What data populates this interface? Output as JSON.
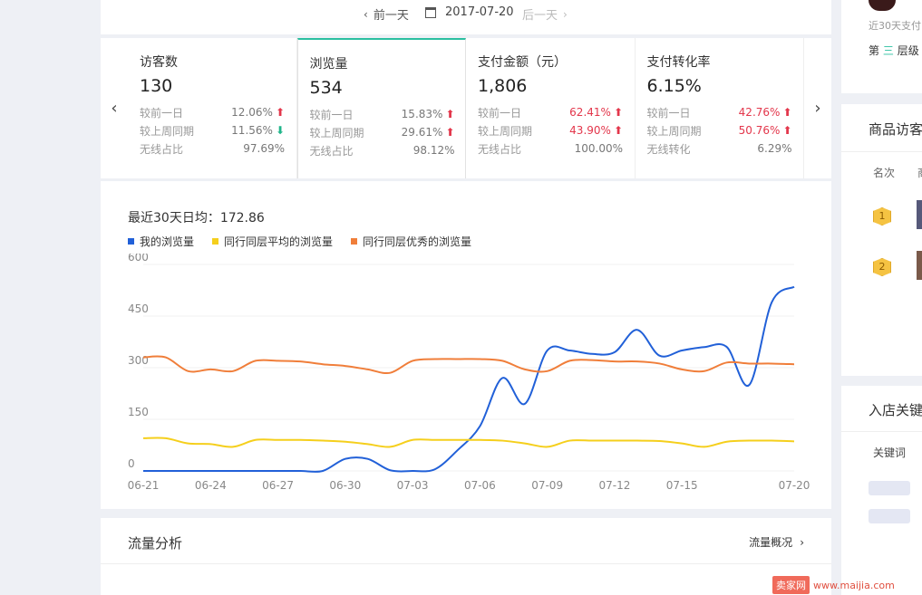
{
  "date_bar": {
    "prev_label": "前一天",
    "date": "2017-07-20",
    "next_label": "后一天"
  },
  "metrics": [
    {
      "title": "访客数",
      "value": "130",
      "rows": [
        {
          "label": "较前一日",
          "pct": "12.06%",
          "trend": "up",
          "emph": false
        },
        {
          "label": "较上周同期",
          "pct": "11.56%",
          "trend": "down",
          "emph": false
        },
        {
          "label": "无线占比",
          "pct": "97.69%",
          "trend": "",
          "emph": false
        }
      ]
    },
    {
      "title": "浏览量",
      "value": "534",
      "rows": [
        {
          "label": "较前一日",
          "pct": "15.83%",
          "trend": "up",
          "emph": false
        },
        {
          "label": "较上周同期",
          "pct": "29.61%",
          "trend": "up",
          "emph": false
        },
        {
          "label": "无线占比",
          "pct": "98.12%",
          "trend": "",
          "emph": false
        }
      ]
    },
    {
      "title": "支付金额（元）",
      "value": "1,806",
      "rows": [
        {
          "label": "较前一日",
          "pct": "62.41%",
          "trend": "up",
          "emph": true
        },
        {
          "label": "较上周同期",
          "pct": "43.90%",
          "trend": "up",
          "emph": true
        },
        {
          "label": "无线占比",
          "pct": "100.00%",
          "trend": "",
          "emph": false
        }
      ]
    },
    {
      "title": "支付转化率",
      "value": "6.15%",
      "rows": [
        {
          "label": "较前一日",
          "pct": "42.76%",
          "trend": "up",
          "emph": true
        },
        {
          "label": "较上周同期",
          "pct": "50.76%",
          "trend": "up",
          "emph": true
        },
        {
          "label": "无线转化",
          "pct": "6.29%",
          "trend": "",
          "emph": false
        }
      ]
    }
  ],
  "chart_panel": {
    "avg_text": "最近30天日均：172.86",
    "legend": [
      {
        "name": "我的浏览量",
        "color": "#2160d8"
      },
      {
        "name": "同行同层平均的浏览量",
        "color": "#f5cf1c"
      },
      {
        "name": "同行同层优秀的浏览量",
        "color": "#f07e3a"
      }
    ]
  },
  "chart_data": {
    "type": "line",
    "x": [
      "06-21",
      "06-22",
      "06-23",
      "06-24",
      "06-25",
      "06-26",
      "06-27",
      "06-28",
      "06-29",
      "06-30",
      "07-01",
      "07-02",
      "07-03",
      "07-04",
      "07-05",
      "07-06",
      "07-07",
      "07-08",
      "07-09",
      "07-10",
      "07-11",
      "07-12",
      "07-13",
      "07-14",
      "07-15",
      "07-16",
      "07-17",
      "07-18",
      "07-19",
      "07-20"
    ],
    "xticks": [
      "06-21",
      "06-24",
      "06-27",
      "06-30",
      "07-03",
      "07-06",
      "07-09",
      "07-12",
      "07-15",
      "07-20"
    ],
    "yticks": [
      0,
      150,
      300,
      450,
      600
    ],
    "ylim": [
      0,
      600
    ],
    "series": [
      {
        "name": "我的浏览量",
        "color": "#2160d8",
        "values": [
          0,
          0,
          0,
          0,
          0,
          0,
          0,
          0,
          0,
          35,
          35,
          2,
          0,
          5,
          60,
          130,
          270,
          195,
          350,
          350,
          340,
          345,
          410,
          335,
          350,
          360,
          360,
          250,
          490,
          535
        ]
      },
      {
        "name": "同行同层平均的浏览量",
        "color": "#f5cf1c",
        "values": [
          95,
          95,
          80,
          78,
          70,
          90,
          90,
          90,
          88,
          85,
          78,
          70,
          90,
          90,
          90,
          90,
          88,
          80,
          70,
          88,
          88,
          88,
          88,
          87,
          80,
          70,
          85,
          88,
          88,
          86
        ]
      },
      {
        "name": "同行同层优秀的浏览量",
        "color": "#f07e3a",
        "values": [
          330,
          330,
          290,
          295,
          290,
          320,
          320,
          318,
          310,
          305,
          295,
          285,
          320,
          325,
          325,
          325,
          320,
          295,
          290,
          320,
          322,
          318,
          318,
          312,
          295,
          290,
          315,
          312,
          312,
          310
        ]
      }
    ]
  },
  "flow": {
    "title": "流量分析",
    "link": "流量概况"
  },
  "right": {
    "sub_text": "近30天支付",
    "level_prefix": "第",
    "level_num": "三",
    "level_suffix": "层级",
    "visitor_title": "商品访客",
    "col_rank": "名次",
    "col_product": "商",
    "rank1": "1",
    "rank2": "2",
    "keyword_title": "入店关键",
    "keyword_col": "关键词"
  },
  "watermark": {
    "logo": "卖家网",
    "url": "www.maijia.com"
  }
}
